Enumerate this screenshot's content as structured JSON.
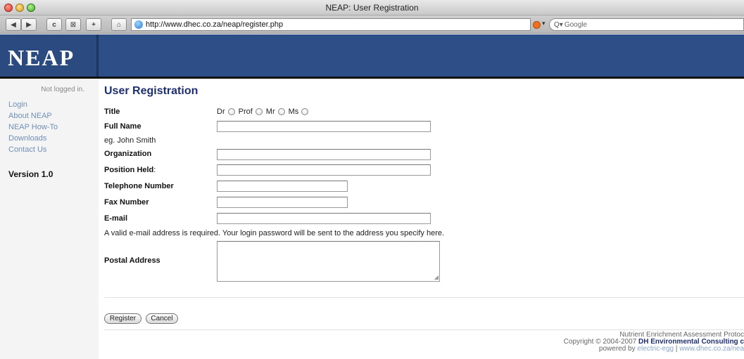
{
  "window": {
    "title": "NEAP: User Registration",
    "url": "http://www.dhec.co.za/neap/register.php",
    "search_placeholder": "Google"
  },
  "header": {
    "logo": "NEAP"
  },
  "sidebar": {
    "status": "Not logged in.",
    "items": [
      {
        "label": "Login"
      },
      {
        "label": "About NEAP"
      },
      {
        "label": "NEAP How-To"
      },
      {
        "label": "Downloads"
      },
      {
        "label": "Contact Us"
      }
    ],
    "version": "Version 1.0"
  },
  "form": {
    "heading": "User Registration",
    "title_label": "Title",
    "title_options": [
      "Dr",
      "Prof",
      "Mr",
      "Ms"
    ],
    "fullname_label": "Full Name",
    "fullname_hint": "eg. John Smith",
    "organization_label": "Organization",
    "position_label": "Position Held",
    "position_colon": ":",
    "telephone_label": "Telephone Number",
    "fax_label": "Fax Number",
    "email_label": "E-mail",
    "email_note": "A valid e-mail address is required. Your login password will be sent to the address you specify here.",
    "postal_label": "Postal Address",
    "register_button": "Register",
    "cancel_button": "Cancel"
  },
  "footer": {
    "line1": "Nutrient Enrichment Assessment Protoc",
    "line2_prefix": "Copyright © 2004-2007",
    "line2_company": "DH Environmental Consulting c",
    "line3_prefix": "powered by",
    "line3_link1": "electric-egg",
    "line3_sep": "|",
    "line3_link2": "www.dhec.co.za/nea"
  }
}
